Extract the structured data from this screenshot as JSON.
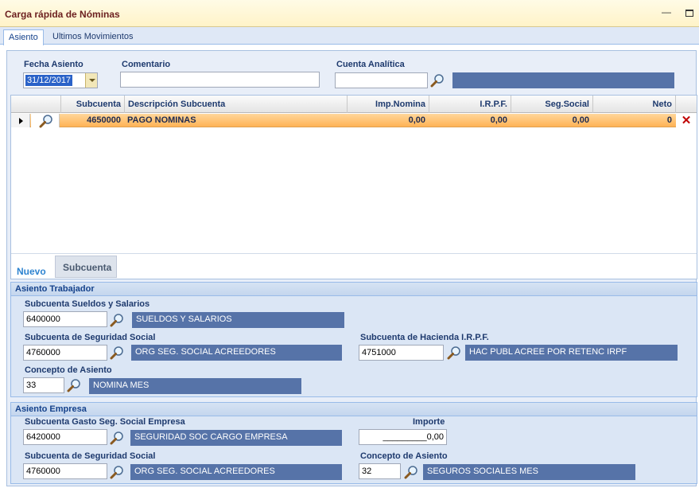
{
  "window": {
    "title": "Carga rápida de Nóminas"
  },
  "tabs": [
    {
      "label": "Asiento"
    },
    {
      "label": "Ultimos Movimientos"
    }
  ],
  "header": {
    "fecha_label": "Fecha Asiento",
    "fecha_value": "31/12/2017",
    "comentario_label": "Comentario",
    "comentario_value": "",
    "cuenta_label": "Cuenta Analítica",
    "cuenta_value": "",
    "cuenta_desc": ""
  },
  "grid": {
    "columns": [
      "Subcuenta",
      "Descripción Subcuenta",
      "Imp.Nomina",
      "I.R.P.F.",
      "Seg.Social",
      "Neto"
    ],
    "rows": [
      {
        "subcuenta": "4650000",
        "descripcion": "PAGO NOMINAS",
        "imp_nomina": "0,00",
        "irpf": "0,00",
        "seg_social": "0,00",
        "neto": "0"
      }
    ],
    "delete_glyph": "✕",
    "nuevo_label": "Nuevo",
    "subcuenta_tab": "Subcuenta"
  },
  "trabajador": {
    "title": "Asiento Trabajador",
    "sueldos_label": "Subcuenta Sueldos y Salarios",
    "sueldos_value": "6400000",
    "sueldos_desc": "SUELDOS Y SALARIOS",
    "ss_label": "Subcuenta de Seguridad Social",
    "ss_value": "4760000",
    "ss_desc": "ORG SEG. SOCIAL ACREEDORES",
    "irpf_label": "Subcuenta de Hacienda I.R.P.F.",
    "irpf_value": "4751000",
    "irpf_desc": "HAC PUBL ACREE POR RETENC IRPF",
    "concepto_label": "Concepto de Asiento",
    "concepto_value": "33",
    "concepto_desc": "NOMINA  MES"
  },
  "empresa": {
    "title": "Asiento Empresa",
    "gasto_label": "Subcuenta Gasto Seg. Social Empresa",
    "gasto_value": "6420000",
    "gasto_desc": "SEGURIDAD SOC CARGO EMPRESA",
    "importe_label": "Importe",
    "importe_value": "_________0,00",
    "ss_label": "Subcuenta de Seguridad Social",
    "ss_value": "4760000",
    "ss_desc": "ORG SEG. SOCIAL ACREEDORES",
    "concepto_label": "Concepto de Asiento",
    "concepto_value": "32",
    "concepto_desc": "SEGUROS SOCIALES MES"
  },
  "colors": {
    "readonly_bg": "#5673a8",
    "row_highlight": "#ffb356",
    "label_color": "#1e3a6e",
    "title_color": "#6b1f1f"
  }
}
